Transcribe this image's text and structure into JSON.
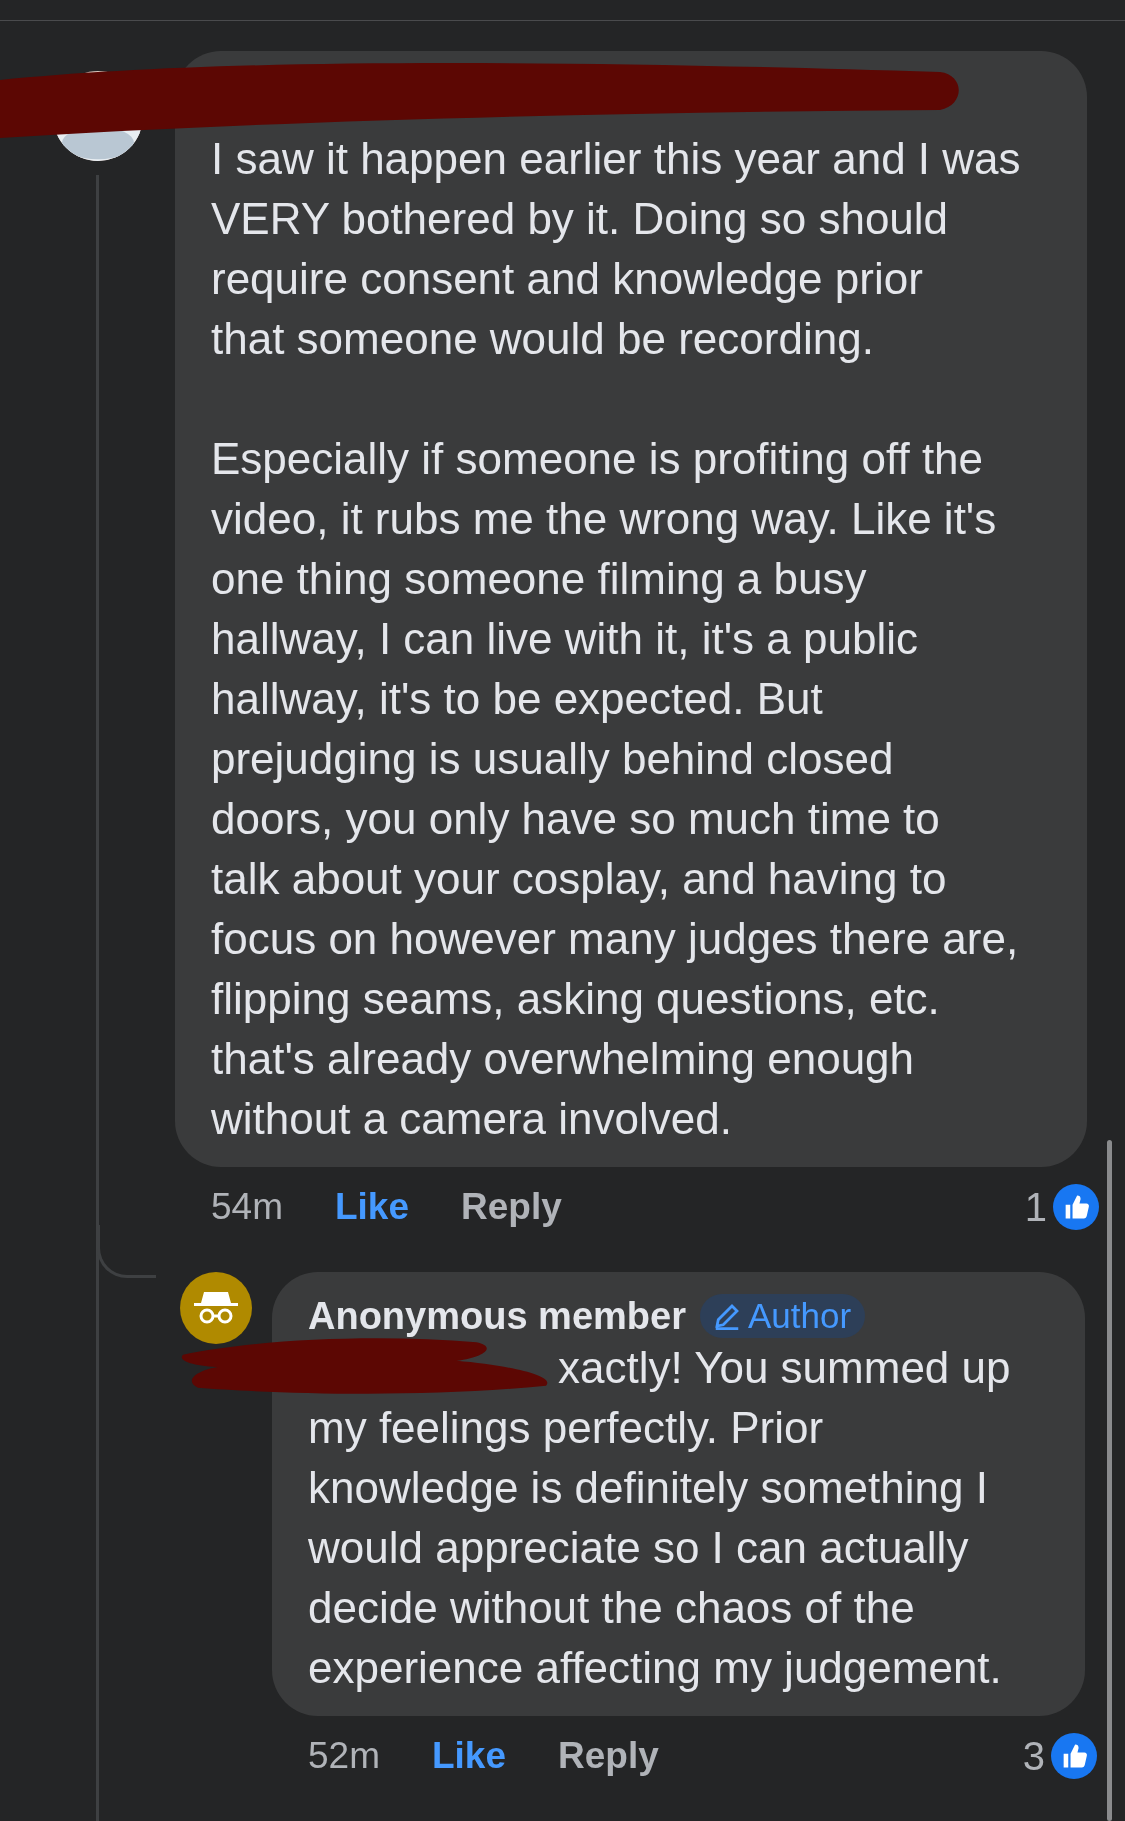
{
  "comments": [
    {
      "paragraphs": [
        "I saw it happen earlier this year and I was\nVERY bothered by it. Doing so should\nrequire consent and knowledge prior\nthat someone would be recording.",
        "Especially if someone is profiting off the\nvideo, it rubs me the wrong way. Like it's\none thing someone filming a busy\nhallway, I can live with it, it's a public\nhallway, it's to be expected. But\nprejudging is usually behind closed\ndoors, you only have so much time to\ntalk about your cosplay, and having to\nfocus on however many judges there are,\nflipping seams, asking questions, etc.\nthat's already overwhelming enough\nwithout a camera involved."
      ],
      "time": "54m",
      "like": "Like",
      "reply": "Reply",
      "reaction_count": "1",
      "liked": true
    },
    {
      "avatar": {
        "kind": "anonymous"
      },
      "author": "Anonymous member",
      "badge": "Author",
      "lead": "xactly! You summed up",
      "paragraphs": [
        "my feelings perfectly. Prior\nknowledge is definitely something I\nwould appreciate so I can actually\ndecide without the chaos of the\nexperience affecting my judgement."
      ],
      "time": "52m",
      "like": "Like",
      "reply": "Reply",
      "reaction_count": "3",
      "liked": true
    }
  ]
}
